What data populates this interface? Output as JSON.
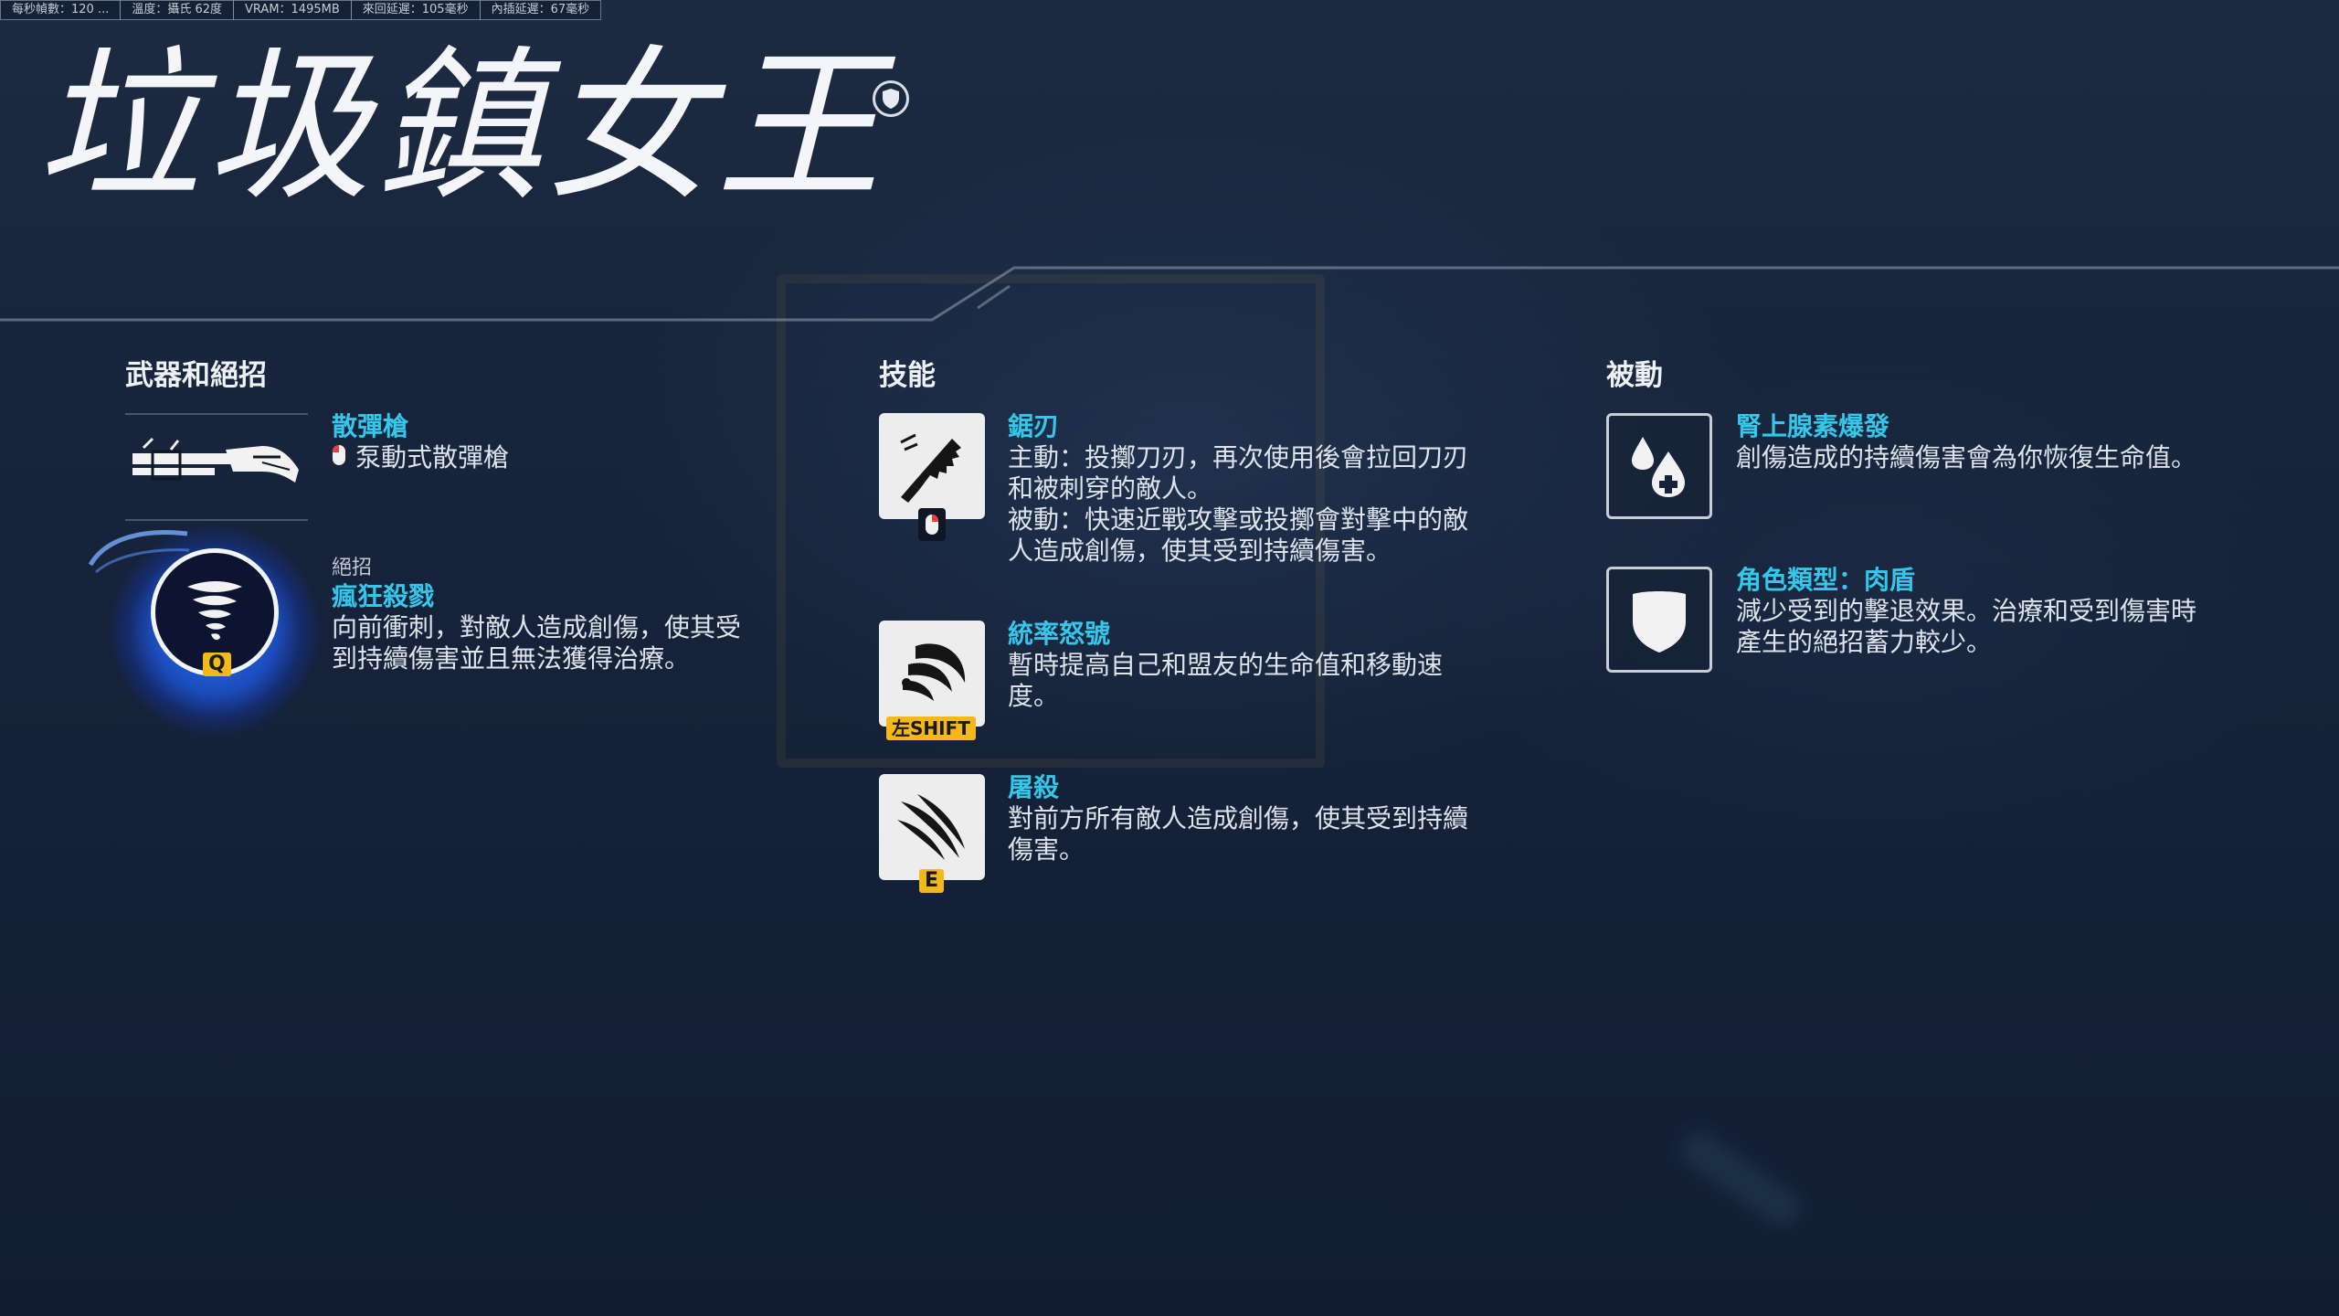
{
  "perf_stats": [
    "每秒幀數：120 ...",
    "溫度：攝氏 62度",
    "VRAM：1495MB",
    "來回延遲：105毫秒",
    "內插延遲：67毫秒"
  ],
  "hero": {
    "name": "垃圾鎮女王",
    "role_icon": "shield-icon"
  },
  "weapons": {
    "heading": "武器和絕招",
    "weapon": {
      "name": "散彈槍",
      "desc": "泵動式散彈槍",
      "icon": "shotgun-icon",
      "input_icon": "mouse-left-icon"
    },
    "ultimate": {
      "label": "絕招",
      "name": "瘋狂殺戮",
      "desc_lines": [
        "向前衝刺，對敵人造成創傷，使其受",
        "到持續傷害並且無法獲得治療。"
      ],
      "key": "Q",
      "icon": "tornado-icon"
    }
  },
  "abilities": {
    "heading": "技能",
    "items": [
      {
        "name": "鋸刃",
        "desc_lines": [
          "主動：投擲刀刃，再次使用後會拉回刀刃",
          "和被刺穿的敵人。",
          "被動：快速近戰攻擊或投擲會對擊中的敵",
          "人造成創傷，使其受到持續傷害。"
        ],
        "key": "",
        "icon": "jagged-blade-icon",
        "input_icon": "mouse-right-icon"
      },
      {
        "name": "統率怒號",
        "desc_lines": [
          "暫時提高自己和盟友的生命值和移動速",
          "度。"
        ],
        "key": "左SHIFT",
        "icon": "shout-icon"
      },
      {
        "name": "屠殺",
        "desc_lines": [
          "對前方所有敵人造成創傷，使其受到持續",
          "傷害。"
        ],
        "key": "E",
        "icon": "claw-slash-icon"
      }
    ]
  },
  "passives": {
    "heading": "被動",
    "items": [
      {
        "name": "腎上腺素爆發",
        "desc_lines": [
          "創傷造成的持續傷害會為你恢復生命值。"
        ],
        "icon": "blood-heal-icon"
      },
      {
        "name": "角色類型：肉盾",
        "desc_lines": [
          "減少受到的擊退效果。治療和受到傷害時",
          "產生的絕招蓄力較少。"
        ],
        "icon": "tank-shield-icon"
      }
    ]
  },
  "colors": {
    "accent": "#35c7ea",
    "key_yellow": "#f2b81c",
    "ult_blue": "#2a6cf0"
  }
}
